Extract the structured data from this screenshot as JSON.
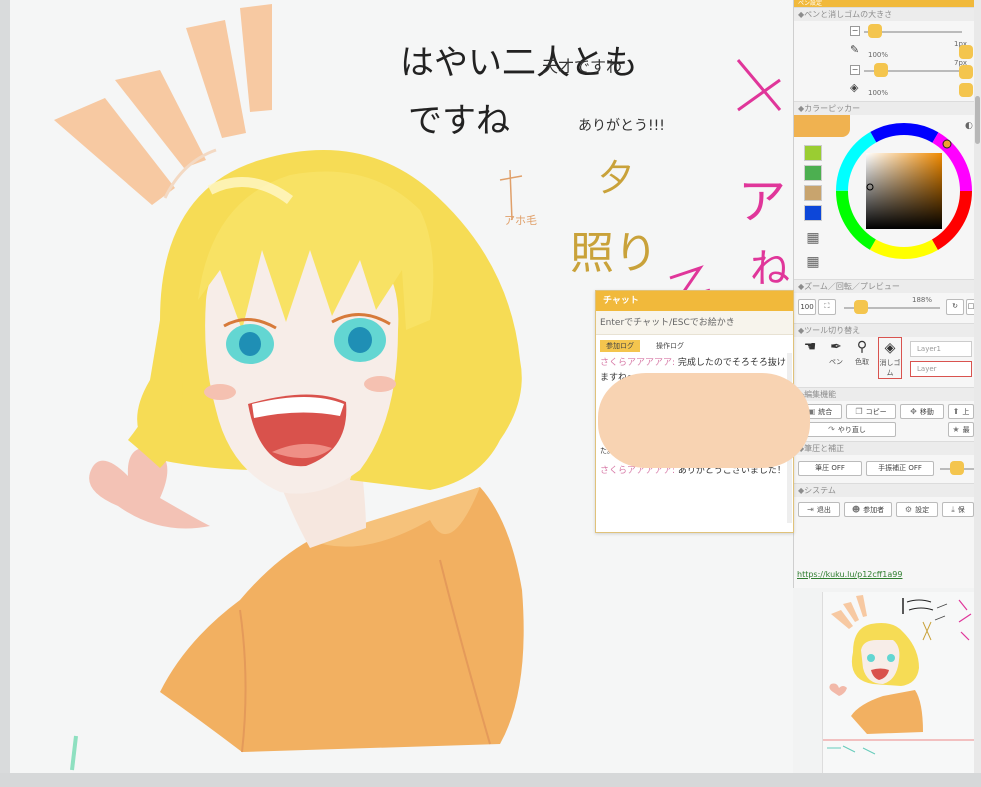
{
  "panel": {
    "header_top": "ペン設定",
    "pen_section": "◆ペンと消しゴムの大きさ",
    "pen_size": "1px",
    "pen_opacity": "100%",
    "eraser_size": "7px",
    "eraser_opacity": "100%",
    "color_section": "◆カラーピッカー",
    "current_color": "#f0b250",
    "swatches": [
      "#9acd32",
      "#4caf50",
      "#c8a46e",
      "#0d47d9"
    ],
    "zoom_section": "◆ズーム／回転／プレビュー",
    "zoom_label": "100",
    "zoom_value": "188%",
    "tool_section": "◆ツール切り替え",
    "tools": [
      "",
      "ペン",
      "色取",
      "消しゴム"
    ],
    "layer_labels": [
      "Layer1",
      "Layer"
    ],
    "edit_section": "◆編集機能",
    "edit_buttons": [
      "統合",
      "コピー",
      "移動",
      "上",
      "やり直し",
      "最"
    ],
    "pressure_section": "◆筆圧と補正",
    "pressure_buttons": [
      "筆圧 OFF",
      "手振補正 OFF"
    ],
    "system_section": "◆システム",
    "system_buttons": [
      "退出",
      "参加者",
      "設定",
      "保"
    ],
    "url": "https://kuku.lu/p12cff1a99"
  },
  "chat": {
    "title": "チャット",
    "input_placeholder": "Enterでチャット/ESCでお絵かき",
    "tabs": [
      "参加ログ",
      "操作ログ"
    ],
    "messages": [
      {
        "who": "さくらアアアアア:",
        "text": " 完成したのでそろそろ抜けますね〜"
      },
      {
        "who": "",
        "text": "た。"
      },
      {
        "who": "さくらアアアアア:",
        "text": " ありがとうございました！"
      }
    ]
  },
  "canvas": {
    "note_lines": [
      "はやい二人とも",
      "天才ですわ",
      "ですね",
      "ありがとう!!!"
    ],
    "side_notes": [
      "アホ毛",
      "夕",
      "照り",
      "ア",
      "ね"
    ]
  },
  "colors": {
    "accent": "#f1b93b",
    "hair": "#f6dc55",
    "hoodie": "#f2b061",
    "blush": "#f2b9a9",
    "speed_lines": "#f7c9a2"
  },
  "icons": {
    "pen": "pen-icon",
    "eraser": "eraser-icon",
    "eyedropper": "eyedropper-icon",
    "hand": "hand-icon"
  }
}
